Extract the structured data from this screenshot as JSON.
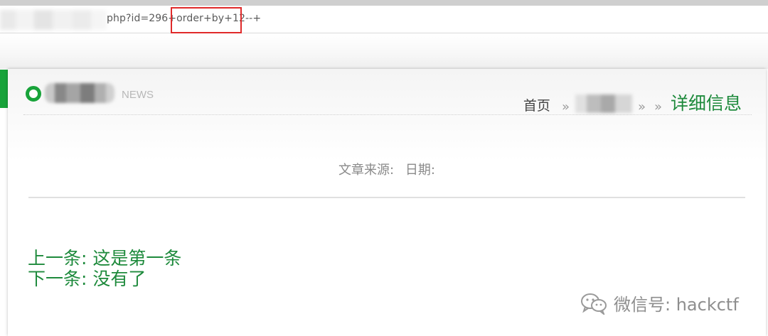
{
  "browser": {
    "url_visible": "php?id=296+order+by+12--+"
  },
  "page": {
    "news_label": "NEWS",
    "breadcrumb": {
      "home": "首页",
      "separator": "»",
      "current": "详细信息"
    },
    "meta": {
      "source_label": "文章来源:",
      "date_label": "日期:"
    },
    "prev_link": "上一条: 这是第一条",
    "next_link": "下一条: 没有了"
  },
  "watermark": {
    "text": "微信号: hackctf"
  },
  "colors": {
    "accent_green": "#1e8a3c",
    "tab_green": "#18a33a",
    "highlight_red": "#e02a2a"
  }
}
